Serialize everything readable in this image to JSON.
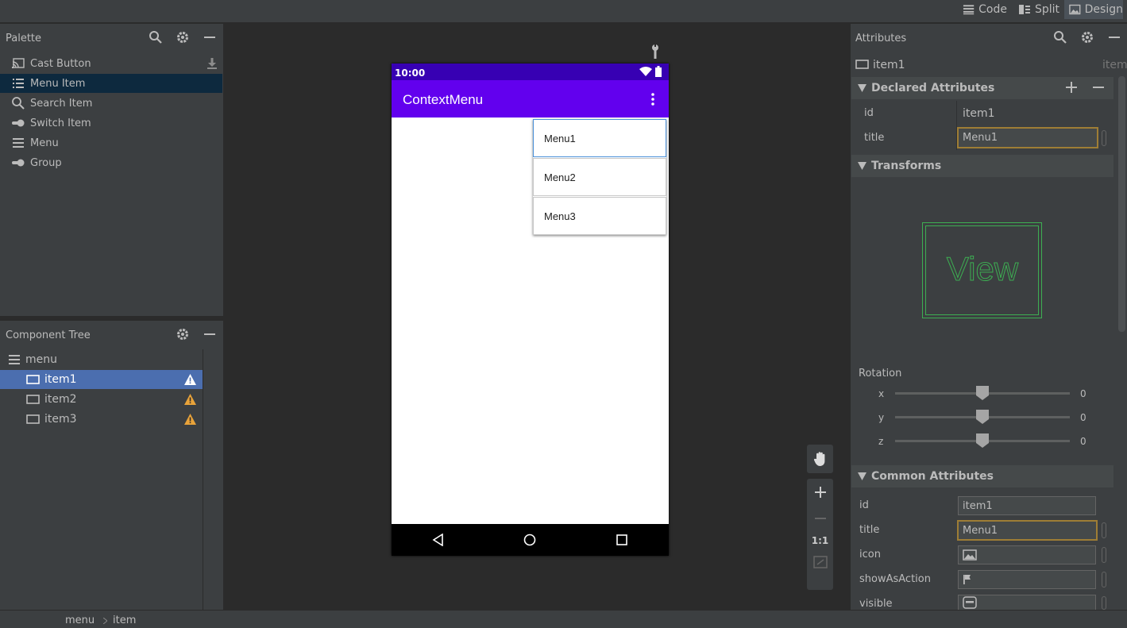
{
  "toolbar": {
    "modes": [
      {
        "label": "Code",
        "icon": "lines-icon"
      },
      {
        "label": "Split",
        "icon": "split-icon"
      },
      {
        "label": "Design",
        "icon": "image-icon"
      }
    ]
  },
  "palette": {
    "title": "Palette",
    "items": [
      {
        "label": "Cast Button",
        "icon": "cast-icon"
      },
      {
        "label": "Menu Item",
        "icon": "list-icon"
      },
      {
        "label": "Search Item",
        "icon": "search-icon"
      },
      {
        "label": "Switch Item",
        "icon": "toggle-icon"
      },
      {
        "label": "Menu",
        "icon": "hamburger-icon"
      },
      {
        "label": "Group",
        "icon": "toggle-icon"
      }
    ]
  },
  "component_tree": {
    "title": "Component Tree",
    "root": "menu",
    "items": [
      "item1",
      "item2",
      "item3"
    ]
  },
  "device": {
    "time": "10:00",
    "app_title": "ContextMenu",
    "menu_items": [
      "Menu1",
      "Menu2",
      "Menu3"
    ]
  },
  "zoom": {
    "one_to_one": "1:1"
  },
  "attributes": {
    "title": "Attributes",
    "component_name": "item1",
    "component_type": "item",
    "declared": {
      "header": "Declared Attributes",
      "rows": [
        {
          "label": "id",
          "value": "item1"
        },
        {
          "label": "title",
          "value": "Menu1"
        }
      ]
    },
    "transforms": {
      "header": "Transforms",
      "preview_text": "View",
      "rotation_label": "Rotation",
      "axes": [
        {
          "label": "x",
          "value": "0"
        },
        {
          "label": "y",
          "value": "0"
        },
        {
          "label": "z",
          "value": "0"
        }
      ]
    },
    "common": {
      "header": "Common Attributes",
      "rows": [
        {
          "label": "id",
          "value": "item1"
        },
        {
          "label": "title",
          "value": "Menu1"
        },
        {
          "label": "icon",
          "value": ""
        },
        {
          "label": "showAsAction",
          "value": ""
        },
        {
          "label": "visible",
          "value": ""
        }
      ]
    }
  },
  "breadcrumb": [
    "menu",
    "item"
  ],
  "colors": {
    "status_bar": "#3700b3",
    "app_bar": "#6200ee",
    "selection": "#4b6eaf",
    "warning": "#e8a33a",
    "preview_green": "#3dae52"
  }
}
